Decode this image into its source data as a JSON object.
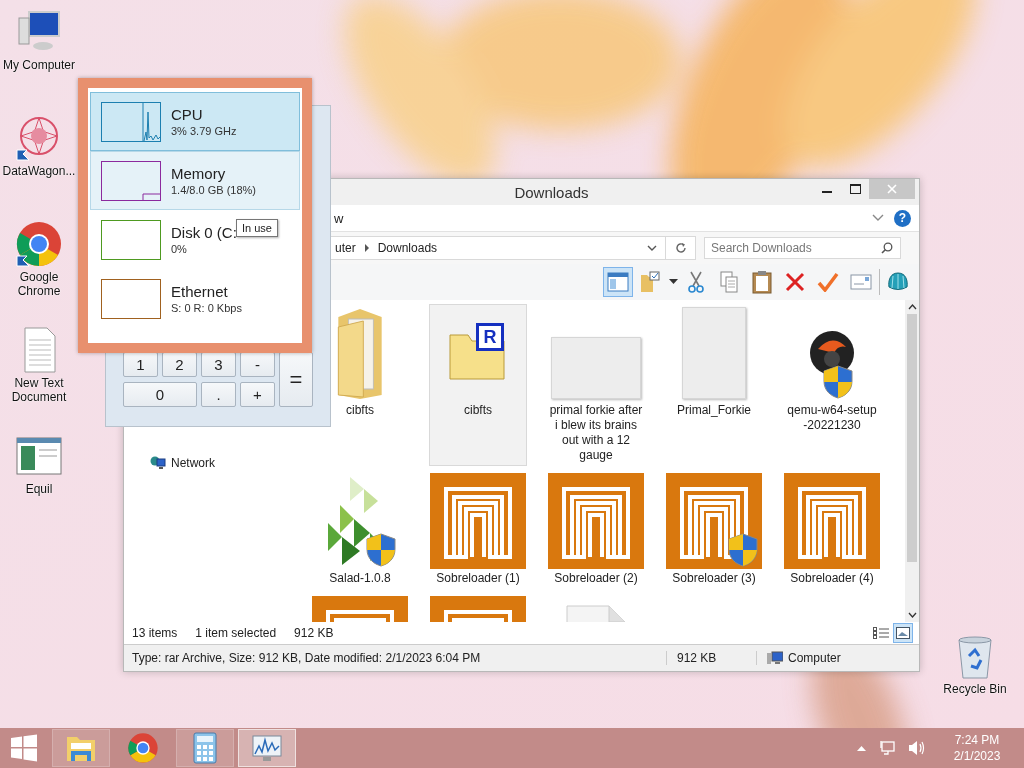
{
  "desktop_icons": [
    {
      "label": "My Computer",
      "kind": "computer",
      "shortcut": false
    },
    {
      "label": "DataWagon...",
      "kind": "mandala",
      "shortcut": true
    },
    {
      "label": "Google Chrome",
      "kind": "chrome",
      "shortcut": true
    },
    {
      "label": "New Text Document",
      "kind": "text",
      "shortcut": false
    },
    {
      "label": "Equil",
      "kind": "app",
      "shortcut": false
    }
  ],
  "recycle_bin": {
    "label": "Recycle Bin"
  },
  "explorer": {
    "title": "Downloads",
    "ribbon_tab": "w",
    "help_mark": "?",
    "address": [
      "uter",
      "Downloads"
    ],
    "search_placeholder": "Search Downloads",
    "layout_pressed": true,
    "nav": [
      {
        "label": "Network"
      }
    ],
    "files": [
      {
        "label": "cibfts",
        "kind": "folder",
        "selected": false,
        "shield": false
      },
      {
        "label": "cibfts",
        "kind": "archive",
        "badge": "R",
        "selected": true,
        "shield": false
      },
      {
        "label": "primal forkie after i blew its brains out with a 12 gauge",
        "kind": "image",
        "selected": false,
        "shield": false
      },
      {
        "label": "Primal_Forkie",
        "kind": "portrait",
        "selected": false,
        "shield": false
      },
      {
        "label": "qemu-w64-setup -20221230",
        "kind": "setup",
        "selected": false,
        "shield": true
      },
      {
        "label": "Salad-1.0.8",
        "kind": "package",
        "selected": false,
        "shield": true
      },
      {
        "label": "Sobreloader (1)",
        "kind": "app",
        "selected": false,
        "shield": false
      },
      {
        "label": "Sobreloader (2)",
        "kind": "app",
        "selected": false,
        "shield": false
      },
      {
        "label": "Sobreloader (3)",
        "kind": "app",
        "selected": false,
        "shield": true
      },
      {
        "label": "Sobreloader (4)",
        "kind": "app",
        "selected": false,
        "shield": false
      },
      {
        "kind": "app",
        "selected": false
      },
      {
        "kind": "app",
        "selected": false
      },
      {
        "kind": "document",
        "selected": false
      }
    ],
    "item_count": "13 items",
    "selection": "1 item selected",
    "selection_size": "912 KB",
    "view_buttons": [
      {
        "selected": false
      },
      {
        "selected": true
      }
    ],
    "details": {
      "summary": "Type: rar Archive, Size: 912 KB, Date modified: 2/1/2023 6:04 PM",
      "size": "912 KB",
      "location": "Computer"
    }
  },
  "calculator": {
    "keys": [
      {
        "label": "1"
      },
      {
        "label": "2"
      },
      {
        "label": "3"
      },
      {
        "label": "-"
      },
      {
        "label": "="
      },
      {
        "label": "0"
      },
      {
        "label": "."
      },
      {
        "label": "+"
      }
    ]
  },
  "performance": [
    {
      "name": "CPU",
      "reading": "3% 3.79 GHz",
      "color": "#1c7fb0",
      "selected": true,
      "hovered": false
    },
    {
      "name": "Memory",
      "reading": "1.4/8.0 GB (18%)",
      "color": "#8b2a9e",
      "selected": false,
      "hovered": true
    },
    {
      "name": "Disk 0 (C:",
      "reading": "0%",
      "color": "#4e9a20",
      "selected": false,
      "hovered": false,
      "tooltip": "In use"
    },
    {
      "name": "Ethernet",
      "reading": "S: 0 R: 0 Kbps",
      "color": "#a0611f",
      "selected": false,
      "hovered": false
    }
  ],
  "taskbar": {
    "buttons": [
      {
        "kind": "explorer",
        "running": true,
        "active": false
      },
      {
        "kind": "chrome",
        "running": false,
        "active": false
      },
      {
        "kind": "calculator",
        "running": true,
        "active": false
      },
      {
        "kind": "monitor",
        "running": true,
        "active": true
      }
    ],
    "clock": {
      "time": "7:24 PM",
      "date": "2/1/2023"
    }
  }
}
